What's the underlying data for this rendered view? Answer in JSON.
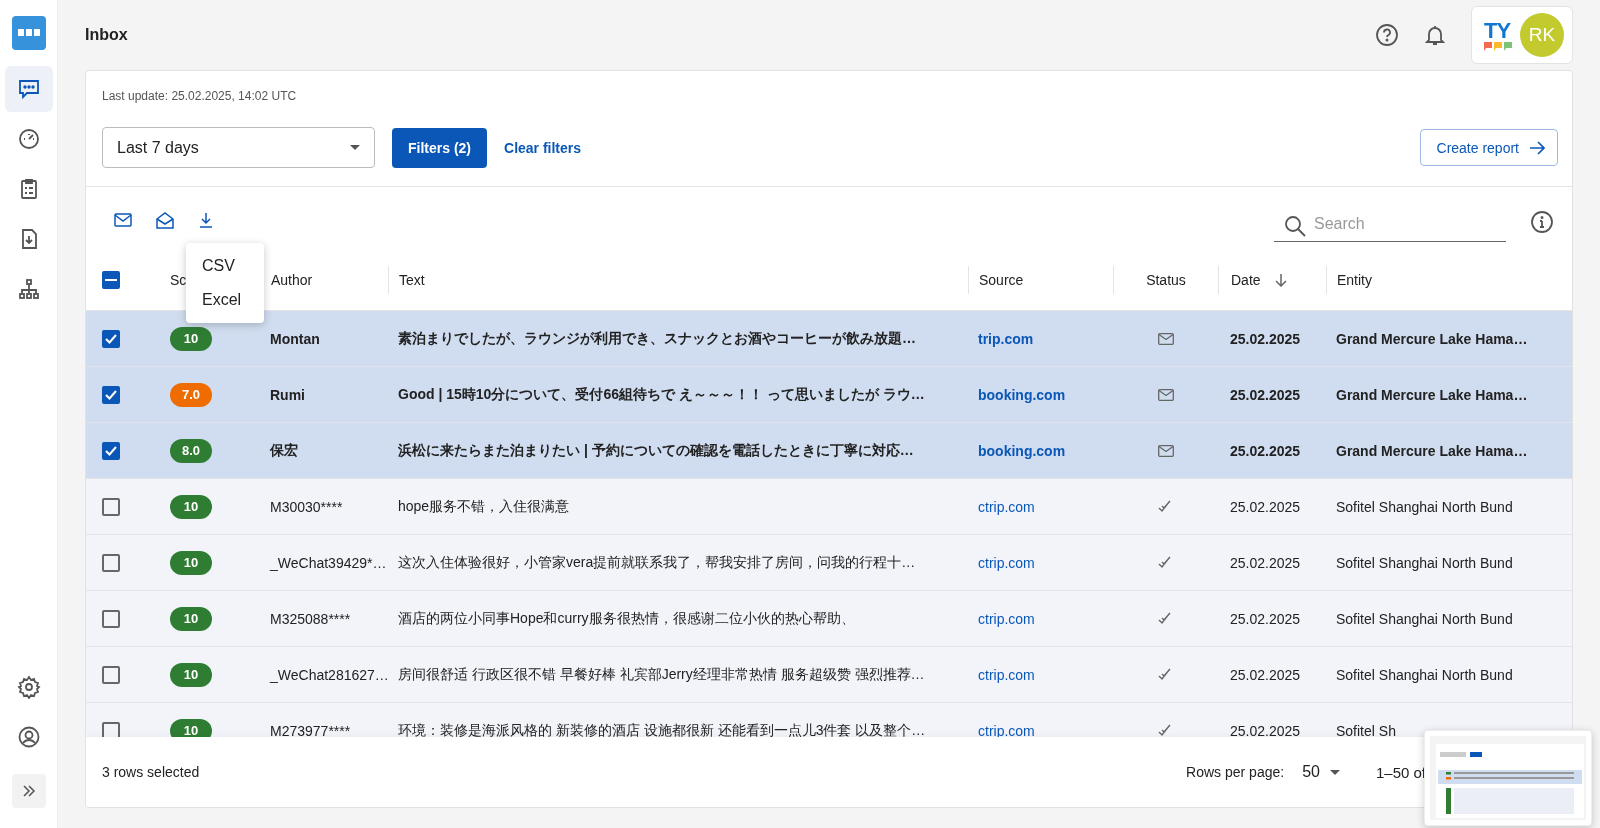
{
  "sidebar": {
    "items": [
      {
        "selected": true
      },
      {
        "selected": false
      },
      {
        "selected": false
      },
      {
        "selected": false
      },
      {
        "selected": false
      }
    ],
    "bottom_items": [
      {
        "selected": false
      },
      {
        "selected": false
      }
    ]
  },
  "header": {
    "title": "Inbox",
    "brand": "TY",
    "avatar_initials": "RK"
  },
  "last_update": "Last update: 25.02.2025, 14:02 UTC",
  "period_select": {
    "value": "Last 7 days"
  },
  "filters_button": "Filters (2)",
  "clear_filters": "Clear filters",
  "create_report": "Create report",
  "search": {
    "placeholder": "Search"
  },
  "export_menu": [
    "CSV",
    "Excel"
  ],
  "table": {
    "select_all": {
      "indeterminate": true
    },
    "columns": [
      "Sc",
      "Author",
      "Text",
      "Source",
      "Status",
      "Date",
      "Entity"
    ],
    "rows": [
      {
        "selected": true,
        "score": "10",
        "color": "#2e7d32",
        "author": "Montan",
        "text": "素泊まりでしたが、ラウンジが利用でき、スナックとお酒やコーヒーが飲み放題…",
        "source": "trip.com",
        "kind": "unread",
        "date": "25.02.2025",
        "entity": "Grand Mercure Lake Hama…"
      },
      {
        "selected": true,
        "score": "7.0",
        "color": "#ef6c00",
        "author": "Rumi",
        "text": "Good | 15時10分について、受付66組待ちで え～～～！！ って思いましたが ラウ…",
        "source": "booking.com",
        "kind": "unread",
        "date": "25.02.2025",
        "entity": "Grand Mercure Lake Hama…"
      },
      {
        "selected": true,
        "score": "8.0",
        "color": "#2e7d32",
        "author": "保宏",
        "text": "浜松に来たらまた泊まりたい | 予約についての確認を電話したときに丁寧に対応…",
        "source": "booking.com",
        "kind": "unread",
        "date": "25.02.2025",
        "entity": "Grand Mercure Lake Hama…"
      },
      {
        "selected": false,
        "score": "10",
        "color": "#2e7d32",
        "author": "M30030****",
        "text": "hope服务不错，入住很满意",
        "source": "ctrip.com",
        "kind": "done",
        "date": "25.02.2025",
        "entity": "Sofitel Shanghai North Bund"
      },
      {
        "selected": false,
        "score": "10",
        "color": "#2e7d32",
        "author": "_WeChat39429*…",
        "text": "这次入住体验很好，小管家vera提前就联系我了，帮我安排了房间，问我的行程十…",
        "source": "ctrip.com",
        "kind": "done",
        "date": "25.02.2025",
        "entity": "Sofitel Shanghai North Bund"
      },
      {
        "selected": false,
        "score": "10",
        "color": "#2e7d32",
        "author": "M325088****",
        "text": "酒店的两位小同事Hope和curry服务很热情，很感谢二位小伙的热心帮助、",
        "source": "ctrip.com",
        "kind": "done",
        "date": "25.02.2025",
        "entity": "Sofitel Shanghai North Bund"
      },
      {
        "selected": false,
        "score": "10",
        "color": "#2e7d32",
        "author": "_WeChat281627…",
        "text": "房间很舒适 行政区很不错 早餐好棒 礼宾部Jerry经理非常热情 服务超级赞 强烈推荐…",
        "source": "ctrip.com",
        "kind": "done",
        "date": "25.02.2025",
        "entity": "Sofitel Shanghai North Bund"
      },
      {
        "selected": false,
        "score": "10",
        "color": "#2e7d32",
        "author": "M273977****",
        "text": "环境：装修是海派风格的 新装修的酒店 设施都很新 还能看到一点儿3件套 以及整个…",
        "source": "ctrip.com",
        "kind": "done",
        "date": "25.02.2025",
        "entity": "Sofitel Sh"
      }
    ]
  },
  "footer": {
    "selection": "3 rows selected",
    "rows_per_page_label": "Rows per page:",
    "rows_per_page": "50",
    "range": "1–50 of"
  }
}
